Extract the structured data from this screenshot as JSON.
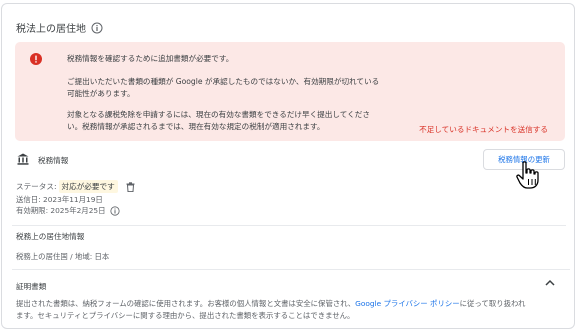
{
  "section": {
    "title": "税法上の居住地"
  },
  "alert": {
    "line1": "税務情報を確認するために追加書類が必要です。",
    "line2": "ご提出いただいた書類の種類が Google が承認したものではないか、有効期限が切れている",
    "line3": "可能性があります。",
    "line4": "対象となる課税免除を申請するには、現在の有効な書類をできるだけ早く提出してくださ",
    "line5": "い。税務情報が承認されるまでは、現在有効な規定の税制が適用されます。",
    "link": "不足しているドキュメントを送信する",
    "color": "#fce8e6"
  },
  "tax_info": {
    "label": "税務情報",
    "update_button": "税務情報の更新",
    "status_label": "ステータス:",
    "status_value": "対応が必要です",
    "sent_date": "送信日: 2023年11月19日",
    "expiry": "有効期限: 2025年2月25日"
  },
  "residency": {
    "heading": "税務上の居住地情報",
    "value": "税務上の居住国 / 地域: 日本"
  },
  "proof": {
    "heading": "証明書類",
    "desc_line1_a": "提出された書類は、納税フォームの確認に使用されます。お客様の個人情報と文書は安全に保管され、",
    "desc_line1_link": "Google プライバシー ポリシー",
    "desc_line1_b": "に従って取り扱われ",
    "desc_line2": "ます。セキュリティとプライバシーに関する理由から、提出された書類を表示することはできません。"
  },
  "icons": {
    "info": "info-icon",
    "alert": "error-icon",
    "bank": "bank-icon",
    "trash": "trash-icon",
    "chevron": "chevron-up-icon",
    "cursor": "hand-pointer-icon"
  }
}
